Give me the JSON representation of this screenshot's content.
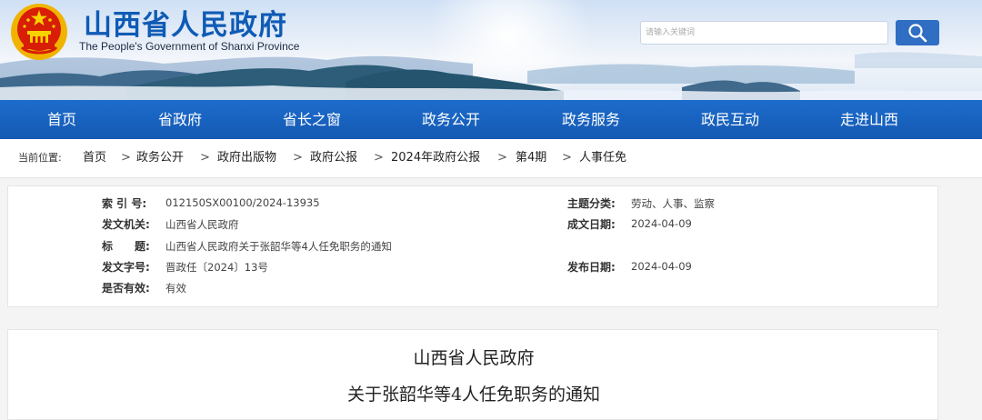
{
  "header": {
    "site_title": "山西省人民政府",
    "site_subtitle": "The People's Government of Shanxi Province",
    "search_placeholder": "请输入关键词",
    "accent_color": "#1b67c6"
  },
  "nav": {
    "items": [
      {
        "label": "首页"
      },
      {
        "label": "省政府"
      },
      {
        "label": "省长之窗"
      },
      {
        "label": "政务公开"
      },
      {
        "label": "政务服务"
      },
      {
        "label": "政民互动"
      },
      {
        "label": "走进山西"
      }
    ]
  },
  "breadcrumb": {
    "lead": "当前位置:",
    "separator": ">",
    "items": [
      "首页",
      "政务公开",
      "政府出版物",
      "政府公报",
      "2024年政府公报",
      "第4期",
      "人事任免"
    ]
  },
  "info": {
    "index_label": "索 引 号:",
    "index_value": "012150SX00100/2024-13935",
    "issuer_label": "发文机关:",
    "issuer_value": "山西省人民政府",
    "title_label": "标　　题:",
    "title_value": "山西省人民政府关于张韶华等4人任免职务的通知",
    "docno_label": "发文字号:",
    "docno_value": "晋政任〔2024〕13号",
    "valid_label": "是否有效:",
    "valid_value": "有效",
    "topic_label": "主题分类:",
    "topic_value": "劳动、人事、监察",
    "created_label": "成文日期:",
    "created_value": "2024-04-09",
    "published_label": "发布日期:",
    "published_value": "2024-04-09"
  },
  "document": {
    "line1": "山西省人民政府",
    "line2": "关于张韶华等4人任免职务的通知"
  }
}
